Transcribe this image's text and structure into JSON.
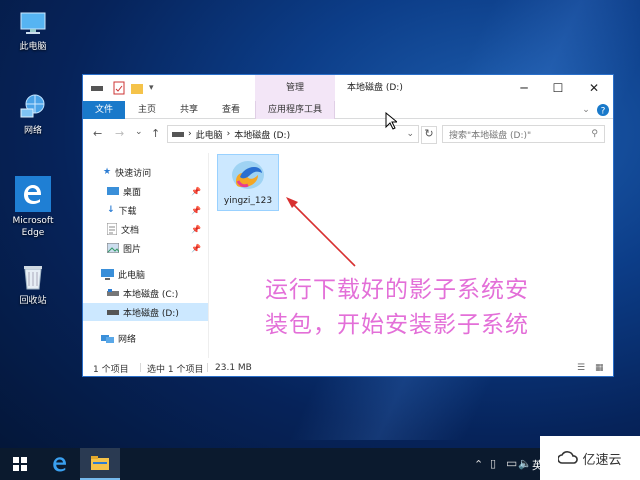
{
  "desktop": {
    "icons": [
      {
        "label": "此电脑"
      },
      {
        "label": "网络"
      },
      {
        "label": "Microsoft\nEdge"
      },
      {
        "label": "回收站"
      }
    ]
  },
  "window": {
    "title": "本地磁盘 (D:)",
    "context_tab": "管理",
    "ribbon_tabs": [
      "文件",
      "主页",
      "共享",
      "查看",
      "应用程序工具"
    ],
    "breadcrumb": [
      "此电脑",
      "本地磁盘 (D:)"
    ],
    "search_placeholder": "搜索\"本地磁盘 (D:)\"",
    "nav": {
      "quick_access": "快速访问",
      "desktop": "桌面",
      "downloads": "下载",
      "documents": "文档",
      "pictures": "图片",
      "this_pc": "此电脑",
      "drive_c": "本地磁盘 (C:)",
      "drive_d": "本地磁盘 (D:)",
      "network": "网络"
    },
    "file": {
      "name": "yingzi_123"
    },
    "status": {
      "count": "1 个项目",
      "selected": "选中 1 个项目",
      "size": "23.1 MB"
    }
  },
  "annotation": {
    "line1": "运行下载好的影子系统安",
    "line2": "装包，开始安装影子系统"
  },
  "tray": {
    "lang": "英"
  },
  "watermark": {
    "text": "亿速云"
  },
  "colors": {
    "accent": "#1979ca",
    "annotation": "#e36fd8",
    "arrow": "#d83030"
  }
}
